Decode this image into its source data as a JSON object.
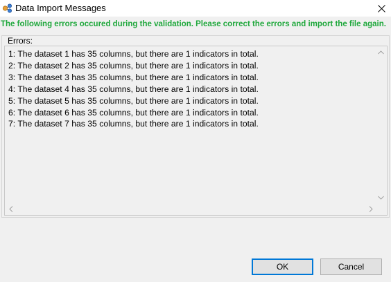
{
  "window": {
    "title": "Data Import Messages",
    "icon": "data-import-icon",
    "close_icon": "close-icon"
  },
  "banner": {
    "text": "The following errors occured during the validation. Please correct the errors and import the file again.",
    "color": "#1fa83c"
  },
  "errors_group": {
    "label": "Errors:",
    "lines": [
      "1: The dataset 1 has 35 columns, but there are 1 indicators in total.",
      "2: The dataset 2 has 35 columns, but there are 1 indicators in total.",
      "3: The dataset 3 has 35 columns, but there are 1 indicators in total.",
      "4: The dataset 4 has 35 columns, but there are 1 indicators in total.",
      "5: The dataset 5 has 35 columns, but there are 1 indicators in total.",
      "6: The dataset 6 has 35 columns, but there are 1 indicators in total.",
      "7: The dataset 7 has 35 columns, but there are 1 indicators in total."
    ]
  },
  "buttons": {
    "ok_label": "OK",
    "cancel_label": "Cancel",
    "accent": "#0078d7"
  }
}
